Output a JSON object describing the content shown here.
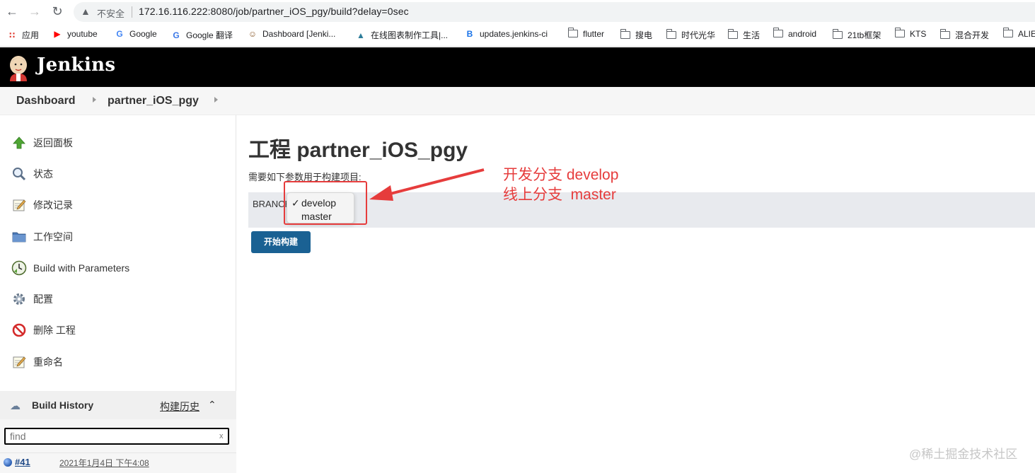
{
  "browser": {
    "insecure_label": "不安全",
    "url": "172.16.116.222:8080/job/partner_iOS_pgy/build?delay=0sec",
    "bookmarks": [
      {
        "label": "应用",
        "icon": "apps-grid-icon"
      },
      {
        "label": "youtube",
        "icon": "youtube-icon"
      },
      {
        "label": "Google",
        "icon": "google-icon"
      },
      {
        "label": "Google 翻译",
        "icon": "google-translate-icon"
      },
      {
        "label": "Dashboard [Jenki...",
        "icon": "jenkins-icon"
      },
      {
        "label": "在线图表制作工具|...",
        "icon": "chart-tool-icon"
      },
      {
        "label": "updates.jenkins-ci",
        "icon": "bracket-b-icon"
      },
      {
        "label": "flutter",
        "icon": "folder-icon"
      },
      {
        "label": "搜电",
        "icon": "folder-icon"
      },
      {
        "label": "时代光华",
        "icon": "folder-icon"
      },
      {
        "label": "生活",
        "icon": "folder-icon"
      },
      {
        "label": "android",
        "icon": "folder-icon"
      },
      {
        "label": "21tb框架",
        "icon": "folder-icon"
      },
      {
        "label": "KTS",
        "icon": "folder-icon"
      },
      {
        "label": "混合开发",
        "icon": "folder-icon"
      },
      {
        "label": "ALIE",
        "icon": "folder-icon"
      }
    ]
  },
  "header": {
    "title": "Jenkins"
  },
  "breadcrumb": [
    "Dashboard",
    "partner_iOS_pgy"
  ],
  "sidebar": {
    "tasks": [
      {
        "label": "返回面板",
        "icon": "up-arrow-icon"
      },
      {
        "label": "状态",
        "icon": "magnifier-icon"
      },
      {
        "label": "修改记录",
        "icon": "notepad-icon"
      },
      {
        "label": "工作空间",
        "icon": "folder-icon"
      },
      {
        "label": "Build with Parameters",
        "icon": "clock-icon"
      },
      {
        "label": "配置",
        "icon": "gear-icon"
      },
      {
        "label": "删除 工程",
        "icon": "no-entry-icon"
      },
      {
        "label": "重命名",
        "icon": "notepad-icon"
      }
    ]
  },
  "build_history": {
    "title": "Build History",
    "trend_link": "构建历史",
    "find_placeholder": "find",
    "clear": "x",
    "builds": [
      {
        "number": "#41",
        "date": "2021年1月4日 下午4:08"
      }
    ]
  },
  "main": {
    "title": "工程 partner_iOS_pgy",
    "description": "需要如下参数用于构建项目:",
    "param_name": "BRANCH",
    "options": [
      "develop",
      "master"
    ],
    "selected": "develop",
    "build_button": "开始构建"
  },
  "annotation": {
    "line1": "开发分支 develop",
    "line2": "线上分支  master"
  },
  "watermark": "@稀土掘金技术社区",
  "colors": {
    "annotation_red": "#e63c3c",
    "build_button": "#1a6193",
    "header_bg": "#000000"
  }
}
